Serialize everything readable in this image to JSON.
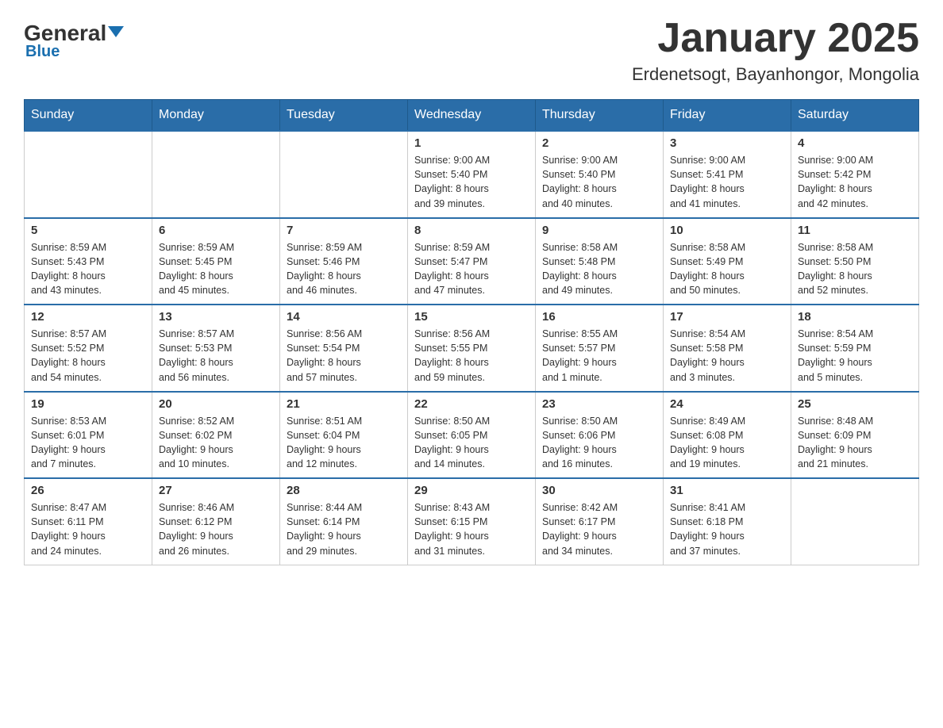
{
  "header": {
    "logo_general": "General",
    "logo_blue": "Blue",
    "title": "January 2025",
    "subtitle": "Erdenetsogt, Bayanhongor, Mongolia"
  },
  "days_of_week": [
    "Sunday",
    "Monday",
    "Tuesday",
    "Wednesday",
    "Thursday",
    "Friday",
    "Saturday"
  ],
  "weeks": [
    [
      {
        "day": "",
        "info": ""
      },
      {
        "day": "",
        "info": ""
      },
      {
        "day": "",
        "info": ""
      },
      {
        "day": "1",
        "info": "Sunrise: 9:00 AM\nSunset: 5:40 PM\nDaylight: 8 hours\nand 39 minutes."
      },
      {
        "day": "2",
        "info": "Sunrise: 9:00 AM\nSunset: 5:40 PM\nDaylight: 8 hours\nand 40 minutes."
      },
      {
        "day": "3",
        "info": "Sunrise: 9:00 AM\nSunset: 5:41 PM\nDaylight: 8 hours\nand 41 minutes."
      },
      {
        "day": "4",
        "info": "Sunrise: 9:00 AM\nSunset: 5:42 PM\nDaylight: 8 hours\nand 42 minutes."
      }
    ],
    [
      {
        "day": "5",
        "info": "Sunrise: 8:59 AM\nSunset: 5:43 PM\nDaylight: 8 hours\nand 43 minutes."
      },
      {
        "day": "6",
        "info": "Sunrise: 8:59 AM\nSunset: 5:45 PM\nDaylight: 8 hours\nand 45 minutes."
      },
      {
        "day": "7",
        "info": "Sunrise: 8:59 AM\nSunset: 5:46 PM\nDaylight: 8 hours\nand 46 minutes."
      },
      {
        "day": "8",
        "info": "Sunrise: 8:59 AM\nSunset: 5:47 PM\nDaylight: 8 hours\nand 47 minutes."
      },
      {
        "day": "9",
        "info": "Sunrise: 8:58 AM\nSunset: 5:48 PM\nDaylight: 8 hours\nand 49 minutes."
      },
      {
        "day": "10",
        "info": "Sunrise: 8:58 AM\nSunset: 5:49 PM\nDaylight: 8 hours\nand 50 minutes."
      },
      {
        "day": "11",
        "info": "Sunrise: 8:58 AM\nSunset: 5:50 PM\nDaylight: 8 hours\nand 52 minutes."
      }
    ],
    [
      {
        "day": "12",
        "info": "Sunrise: 8:57 AM\nSunset: 5:52 PM\nDaylight: 8 hours\nand 54 minutes."
      },
      {
        "day": "13",
        "info": "Sunrise: 8:57 AM\nSunset: 5:53 PM\nDaylight: 8 hours\nand 56 minutes."
      },
      {
        "day": "14",
        "info": "Sunrise: 8:56 AM\nSunset: 5:54 PM\nDaylight: 8 hours\nand 57 minutes."
      },
      {
        "day": "15",
        "info": "Sunrise: 8:56 AM\nSunset: 5:55 PM\nDaylight: 8 hours\nand 59 minutes."
      },
      {
        "day": "16",
        "info": "Sunrise: 8:55 AM\nSunset: 5:57 PM\nDaylight: 9 hours\nand 1 minute."
      },
      {
        "day": "17",
        "info": "Sunrise: 8:54 AM\nSunset: 5:58 PM\nDaylight: 9 hours\nand 3 minutes."
      },
      {
        "day": "18",
        "info": "Sunrise: 8:54 AM\nSunset: 5:59 PM\nDaylight: 9 hours\nand 5 minutes."
      }
    ],
    [
      {
        "day": "19",
        "info": "Sunrise: 8:53 AM\nSunset: 6:01 PM\nDaylight: 9 hours\nand 7 minutes."
      },
      {
        "day": "20",
        "info": "Sunrise: 8:52 AM\nSunset: 6:02 PM\nDaylight: 9 hours\nand 10 minutes."
      },
      {
        "day": "21",
        "info": "Sunrise: 8:51 AM\nSunset: 6:04 PM\nDaylight: 9 hours\nand 12 minutes."
      },
      {
        "day": "22",
        "info": "Sunrise: 8:50 AM\nSunset: 6:05 PM\nDaylight: 9 hours\nand 14 minutes."
      },
      {
        "day": "23",
        "info": "Sunrise: 8:50 AM\nSunset: 6:06 PM\nDaylight: 9 hours\nand 16 minutes."
      },
      {
        "day": "24",
        "info": "Sunrise: 8:49 AM\nSunset: 6:08 PM\nDaylight: 9 hours\nand 19 minutes."
      },
      {
        "day": "25",
        "info": "Sunrise: 8:48 AM\nSunset: 6:09 PM\nDaylight: 9 hours\nand 21 minutes."
      }
    ],
    [
      {
        "day": "26",
        "info": "Sunrise: 8:47 AM\nSunset: 6:11 PM\nDaylight: 9 hours\nand 24 minutes."
      },
      {
        "day": "27",
        "info": "Sunrise: 8:46 AM\nSunset: 6:12 PM\nDaylight: 9 hours\nand 26 minutes."
      },
      {
        "day": "28",
        "info": "Sunrise: 8:44 AM\nSunset: 6:14 PM\nDaylight: 9 hours\nand 29 minutes."
      },
      {
        "day": "29",
        "info": "Sunrise: 8:43 AM\nSunset: 6:15 PM\nDaylight: 9 hours\nand 31 minutes."
      },
      {
        "day": "30",
        "info": "Sunrise: 8:42 AM\nSunset: 6:17 PM\nDaylight: 9 hours\nand 34 minutes."
      },
      {
        "day": "31",
        "info": "Sunrise: 8:41 AM\nSunset: 6:18 PM\nDaylight: 9 hours\nand 37 minutes."
      },
      {
        "day": "",
        "info": ""
      }
    ]
  ]
}
